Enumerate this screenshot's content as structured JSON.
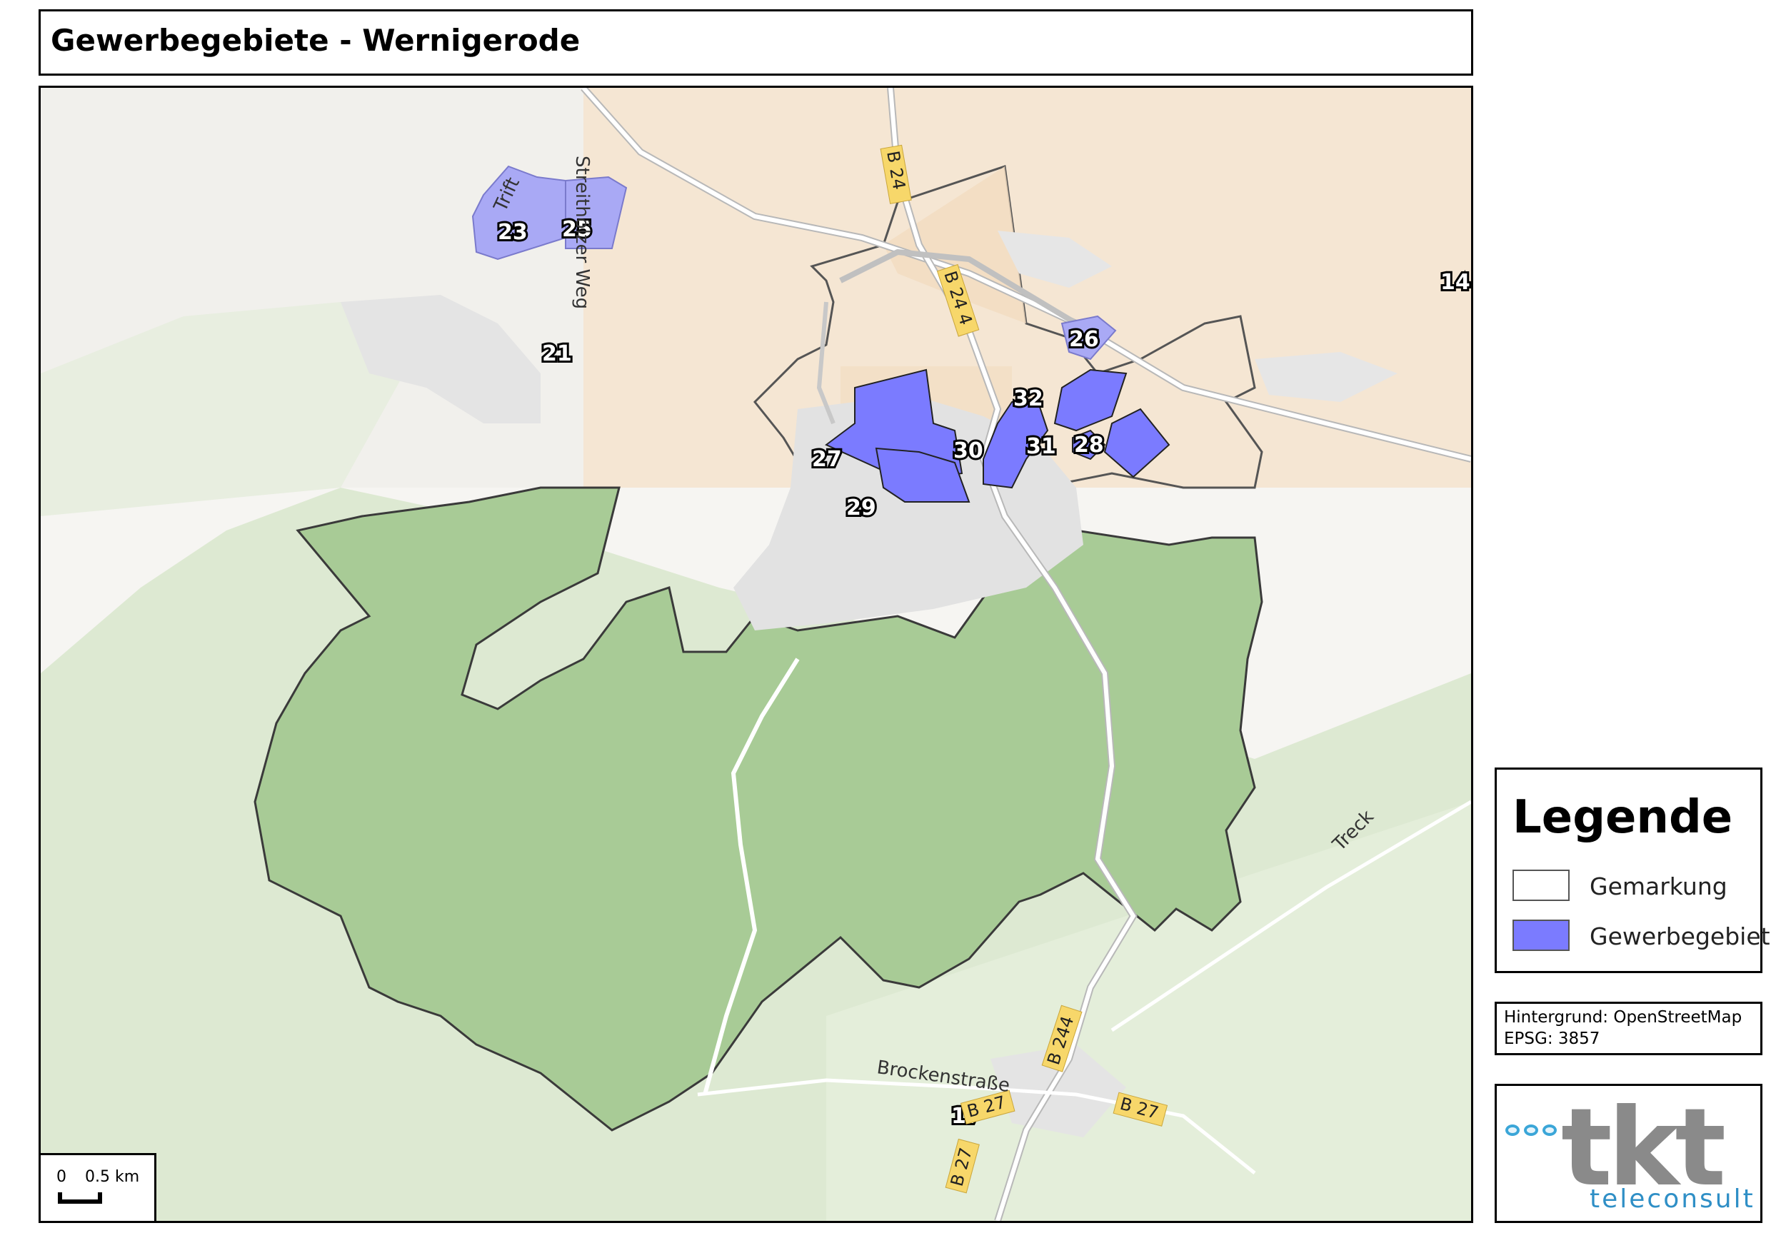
{
  "title": "Gewerbegebiete - Wernigerode",
  "legend": {
    "title": "Legende",
    "items": [
      {
        "label": "Gemarkung",
        "color": "#ffffff"
      },
      {
        "label": "Gewerbegebiet",
        "color": "#7b7bff"
      }
    ]
  },
  "info": {
    "line1": "Hintergrund: OpenStreetMap",
    "line2": "EPSG: 3857"
  },
  "scale": {
    "zero": "0",
    "distance": "0.5 km"
  },
  "logo": {
    "main": "tkt",
    "sub": "teleconsult"
  },
  "colors": {
    "gewerbe_fill": "#7b7bff",
    "gewerbe_light": "#a9a9f5",
    "forest": "#a8cb96",
    "forest_light": "#d8e8cd",
    "farmland": "#f5e3cc",
    "urban": "#e3e3e3",
    "road_label_bg": "#f7d76a"
  },
  "area_labels": {
    "a23": "23",
    "a25": "25",
    "a21": "21",
    "a14": "14",
    "a26": "26",
    "a32": "32",
    "a30": "30",
    "a31": "31",
    "a28": "28",
    "a27": "27",
    "a29": "29",
    "a17": "17"
  },
  "roads": {
    "b244_top": "B 24",
    "b244_mid": "B 24 4",
    "b244_south": "B 244",
    "b27_a": "B 27",
    "b27_b": "B 27",
    "b27_c": "B 27"
  },
  "streets": {
    "streithoelzer": "Streithölzer Weg",
    "trift": "Trift",
    "brocken": "Brockenstraße",
    "treck": "Treck"
  }
}
